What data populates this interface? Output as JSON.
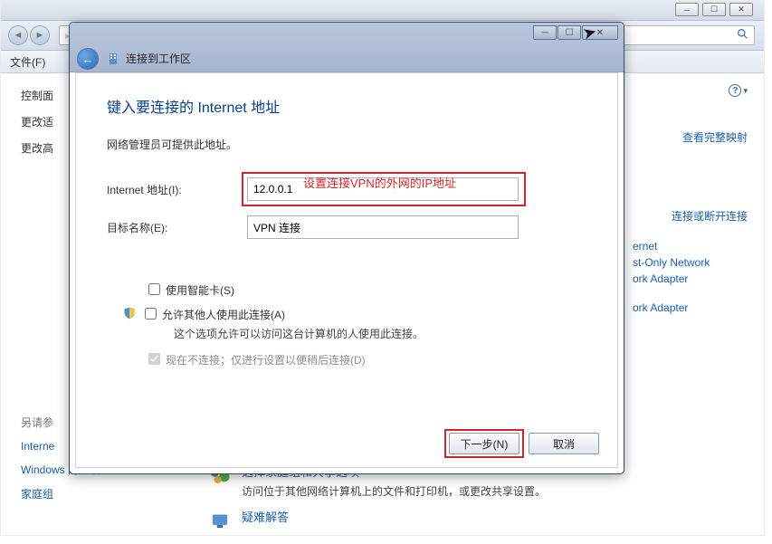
{
  "bg": {
    "menubar_file": "文件(F)",
    "sidebar": {
      "items": [
        "控制面",
        "更改适",
        "更改高"
      ],
      "sep_label": "另请参",
      "links": [
        "Interne",
        "Windows 防火墙",
        "家庭组"
      ]
    },
    "right": {
      "help": "?",
      "view_map": "查看完整映射",
      "conn_disconnect": "连接或断开连接",
      "cut_items": [
        "ernet",
        "st-Only Network",
        "ork Adapter",
        "ork Adapter"
      ]
    },
    "mid": {
      "row1_title": "选择家庭组和共享选项",
      "row1_desc": "访问位于其他网络计算机上的文件和打印机，或更改共享设置。",
      "row2_title": "疑难解答"
    }
  },
  "dialog": {
    "title": "连接到工作区",
    "heading": "键入要连接的 Internet 地址",
    "info": "网络管理员可提供此地址。",
    "addr_label": "Internet 地址(I):",
    "addr_value": "12.0.0.1",
    "red_annotation": "设置连接VPN的外网的IP地址",
    "dest_label": "目标名称(E):",
    "dest_value": "VPN 连接",
    "chk_smartcard": "使用智能卡(S)",
    "chk_allow_others": "允许其他人使用此连接(A)",
    "chk_allow_desc": "这个选项允许可以访问这台计算机的人使用此连接。",
    "chk_defer": "现在不连接；仅进行设置以便稍后连接(D)",
    "btn_next": "下一步(N)",
    "btn_cancel": "取消"
  }
}
